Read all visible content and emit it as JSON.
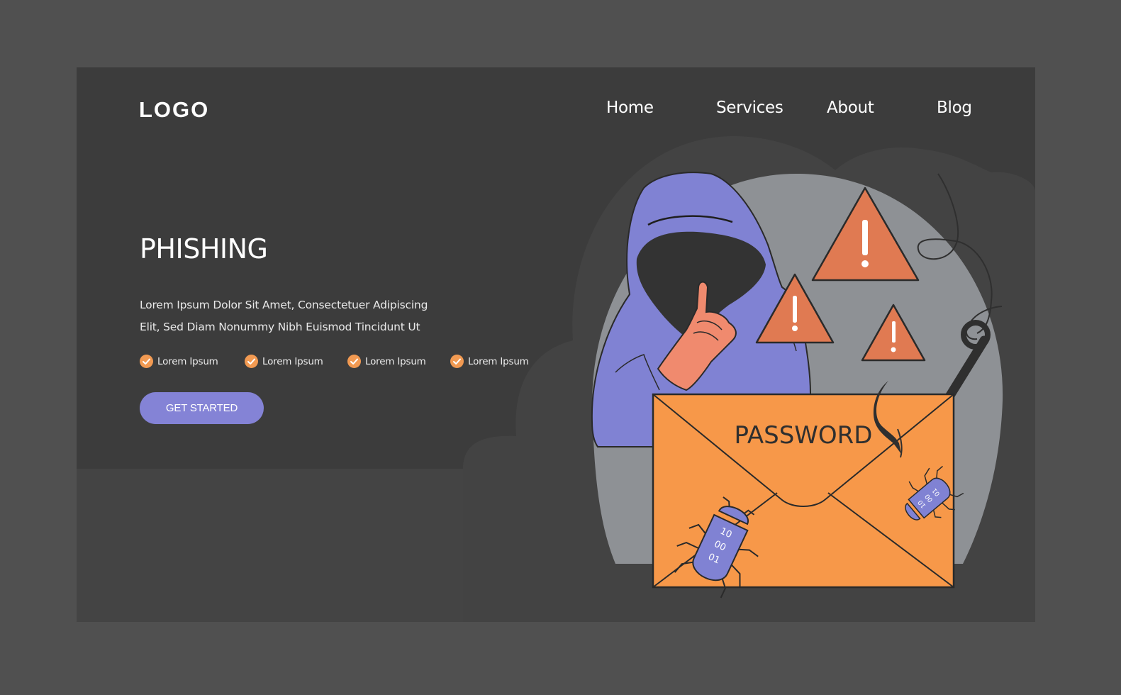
{
  "header": {
    "logo": "LOGO",
    "nav": [
      {
        "label": "Home"
      },
      {
        "label": "Services"
      },
      {
        "label": "About"
      },
      {
        "label": "Blog"
      }
    ]
  },
  "hero": {
    "title": "PHISHING",
    "description_lines": [
      "Lorem Ipsum Dolor Sit Amet, Consectetuer Adipiscing",
      "Elit, Sed Diam Nonummy Nibh Euismod Tincidunt Ut"
    ],
    "features": [
      {
        "label": "Lorem Ipsum",
        "icon": "check-circle-icon"
      },
      {
        "label": "Lorem Ipsum",
        "icon": "check-circle-icon"
      },
      {
        "label": "Lorem Ipsum",
        "icon": "check-circle-icon"
      },
      {
        "label": "Lorem Ipsum",
        "icon": "check-circle-icon"
      }
    ],
    "cta_label": "GET STARTED"
  },
  "illustration": {
    "envelope_text": "PASSWORD",
    "bug_large_code": [
      "10",
      "00",
      "01"
    ],
    "bug_small_code": [
      "10",
      "00",
      "01"
    ],
    "warning_symbol": "!"
  },
  "colors": {
    "outer_bg": "#505050",
    "page_bg": "#444444",
    "hero_bg": "#3c3c3c",
    "accent_purple": "#8483d6",
    "accent_orange": "#f29a52",
    "warning_orange": "#e07a52",
    "skin": "#f08a6e",
    "circle_gray": "#8e9195"
  }
}
